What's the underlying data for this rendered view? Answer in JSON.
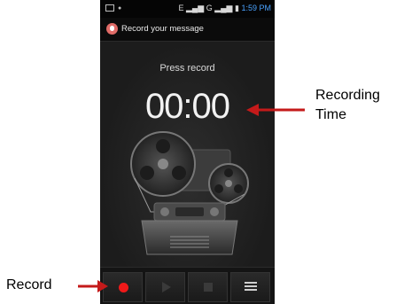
{
  "status_bar": {
    "network": "E",
    "carrier": "G",
    "time": "1:59 PM"
  },
  "app": {
    "title": "Record your message",
    "icon": "microphone-icon"
  },
  "recorder": {
    "state_label": "Press record",
    "elapsed": "00:00"
  },
  "controls": [
    {
      "name": "record-button",
      "icon": "record-icon",
      "color": "#f01919",
      "enabled": true
    },
    {
      "name": "play-button",
      "icon": "play-icon",
      "enabled": false
    },
    {
      "name": "stop-button",
      "icon": "stop-icon",
      "enabled": false
    },
    {
      "name": "list-button",
      "icon": "list-icon",
      "enabled": true
    }
  ],
  "annotations": {
    "recording_time_line1": "Recording",
    "recording_time_line2": "Time",
    "record": "Record",
    "arrow_color": "#c41a1a"
  }
}
